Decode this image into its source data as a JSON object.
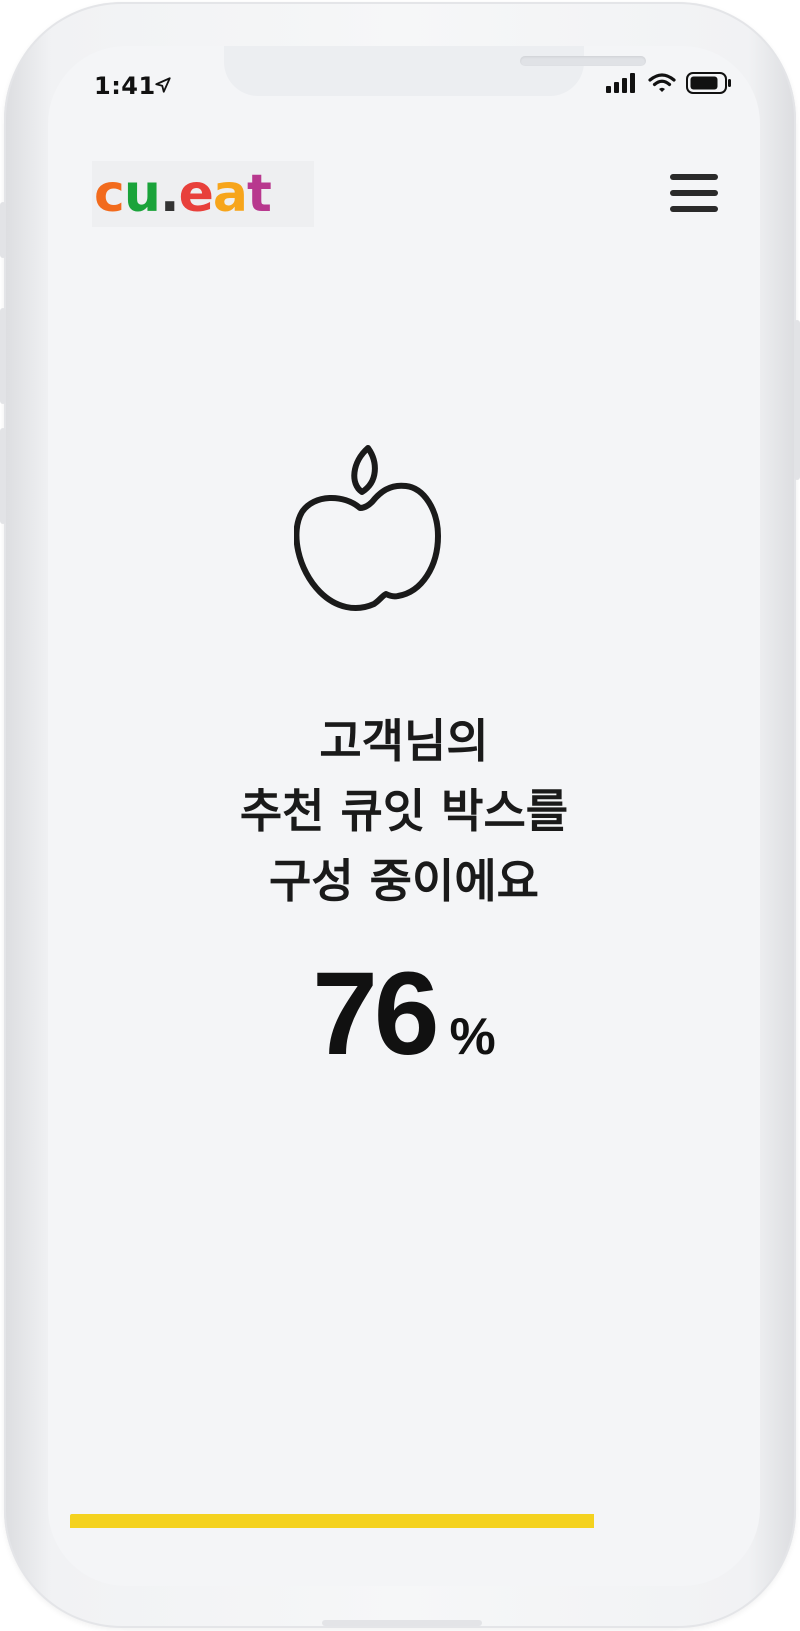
{
  "status_bar": {
    "time": "1:41",
    "location_icon": "location-arrow-icon",
    "signal_icon": "cellular-signal-icon",
    "wifi_icon": "wifi-icon",
    "battery_icon": "battery-icon"
  },
  "header": {
    "logo": {
      "parts": [
        {
          "text": "c",
          "color": "#f26b1d"
        },
        {
          "text": "u",
          "color": "#1aa33a"
        },
        {
          "text": ".",
          "color": "#333333"
        },
        {
          "text": "e",
          "color": "#e8403b"
        },
        {
          "text": "a",
          "color": "#f7a51b"
        },
        {
          "text": "t",
          "color": "#b8388e"
        }
      ]
    },
    "menu_icon": "hamburger-menu-icon"
  },
  "main": {
    "icon": "apple-icon",
    "title_lines": [
      "고객님의",
      "추천 큐잇 박스를",
      "구성 중이에요"
    ],
    "progress_value": "76",
    "progress_unit": "%",
    "progress_fraction": 0.76
  },
  "colors": {
    "accent": "#f4d21f",
    "text": "#1a1a1a",
    "background": "#f4f5f7"
  }
}
